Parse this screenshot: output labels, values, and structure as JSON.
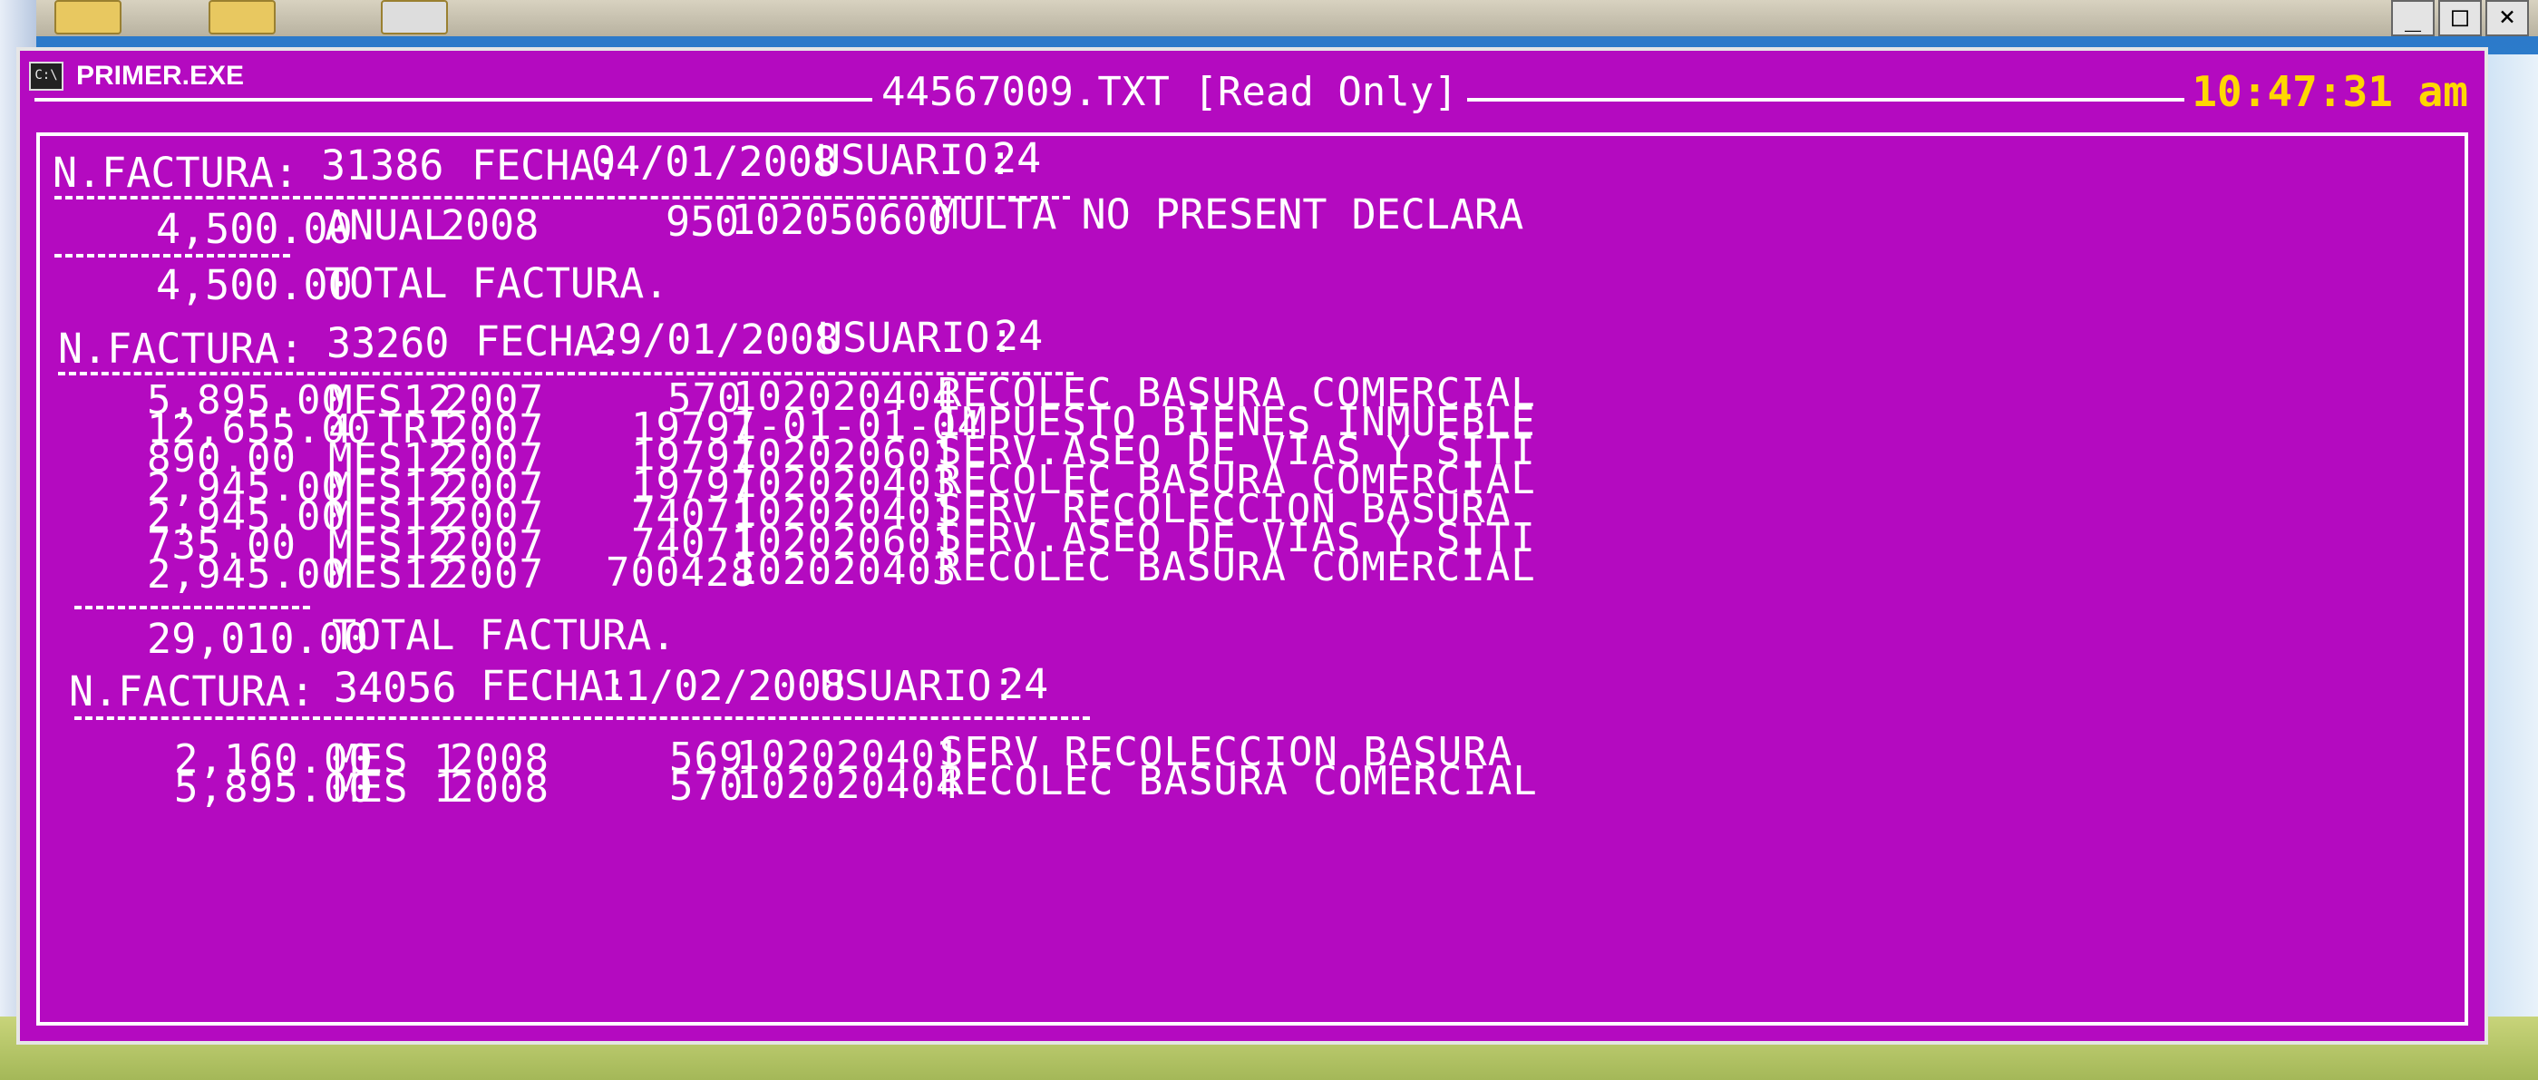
{
  "window": {
    "title": "PRIMER.EXE",
    "icon_label": "C:\\",
    "document": "44567009.TXT [Read Only]",
    "clock": "10:47:31 am"
  },
  "desktop": {
    "caption_buttons": [
      "_",
      "□",
      "×"
    ]
  },
  "invoices": [
    {
      "n_label": "N.FACTURA:",
      "number": "31386",
      "fecha_label": "FECHA:",
      "date": "04/01/2008",
      "user_label": "USUARIO:",
      "user": "24",
      "rows": [
        {
          "amount": "4,500.00",
          "period": "ANUAL",
          "year": "2008",
          "code": "950",
          "account": "102050600",
          "description": "MULTA NO PRESENT DECLARA"
        }
      ],
      "total_amount": "4,500.00",
      "total_label": "TOTAL FACTURA."
    },
    {
      "n_label": "N.FACTURA:",
      "number": "33260",
      "fecha_label": "FECHA:",
      "date": "29/01/2008",
      "user_label": "USUARIO:",
      "user": "24",
      "rows": [
        {
          "amount": "5,895.00",
          "period": "MES12",
          "year": "2007",
          "code": "570",
          "account": "102020404",
          "description": "RECOLEC BASURA COMERCIAL"
        },
        {
          "amount": "12,655.00",
          "period": "4 TRI",
          "year": "2007",
          "code": "19797",
          "account": "1-01-01-04",
          "description": "IMPUESTO BIENES INMUEBLE"
        },
        {
          "amount": "890.00",
          "period": "MES12",
          "year": "2007",
          "code": "19797",
          "account": "102020601",
          "description": "SERV.ASEO DE VIAS Y SITI"
        },
        {
          "amount": "2,945.00",
          "period": "MES12",
          "year": "2007",
          "code": "19797",
          "account": "102020403",
          "description": "RECOLEC BASURA COMERCIAL"
        },
        {
          "amount": "2,945.00",
          "period": "MES12",
          "year": "2007",
          "code": "74071",
          "account": "102020401",
          "description": "SERV RECOLECCION BASURA"
        },
        {
          "amount": "735.00",
          "period": "MES12",
          "year": "2007",
          "code": "74071",
          "account": "102020601",
          "description": "SERV.ASEO DE VIAS Y SITI"
        },
        {
          "amount": "2,945.00",
          "period": "MES12",
          "year": "2007",
          "code": "700428",
          "account": "102020403",
          "description": "RECOLEC BASURA COMERCIAL"
        }
      ],
      "total_amount": "29,010.00",
      "total_label": "TOTAL FACTURA."
    },
    {
      "n_label": "N.FACTURA:",
      "number": "34056",
      "fecha_label": "FECHA:",
      "date": "11/02/2008",
      "user_label": "USUARIO:",
      "user": "24",
      "rows": [
        {
          "amount": "2,160.00",
          "period": "MES 1",
          "year": "2008",
          "code": "569",
          "account": "102020401",
          "description": "SERV RECOLECCION BASURA"
        },
        {
          "amount": "5,895.00",
          "period": "MES 1",
          "year": "2008",
          "code": "570",
          "account": "102020404",
          "description": "RECOLEC BASURA COMERCIAL"
        }
      ]
    }
  ]
}
